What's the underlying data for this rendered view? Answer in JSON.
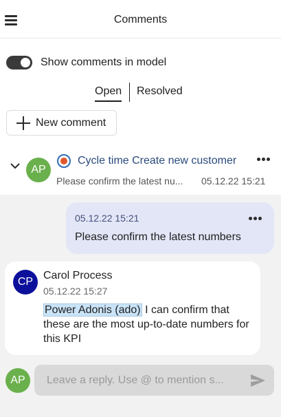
{
  "header": {
    "title": "Comments",
    "menu_icon": "hamburger-menu-icon"
  },
  "toggle": {
    "label": "Show comments in model",
    "state": "on"
  },
  "tabs": [
    {
      "label": "Open",
      "active": true
    },
    {
      "label": "Resolved",
      "active": false
    }
  ],
  "new_comment": {
    "label": "New comment",
    "icon": "plus-icon"
  },
  "thread": {
    "author_initials": "AP",
    "title": "Cycle time Create new customer",
    "preview": "Please confirm the latest nu...",
    "date": "05.12.22 15:21",
    "expanded": true
  },
  "messages": [
    {
      "date": "05.12.22 15:21",
      "text": "Please confirm the latest numbers",
      "own": true
    },
    {
      "initials": "CP",
      "author": "Carol Process",
      "date": "05.12.22 15:27",
      "mention": "Power Adonis (ado)",
      "text": " I can confirm that these are the most up-to-date numbers for this KPI",
      "own": false
    }
  ],
  "reply": {
    "initials": "AP",
    "placeholder": "Leave a reply. Use @ to mention s..."
  },
  "colors": {
    "accent_text": "#2a4a7b",
    "avatar_ap": "#6ab04c",
    "avatar_cp": "#0c109b",
    "own_bubble": "#e3e6f7",
    "thread_bg": "#f2f2f2",
    "mention_bg": "#c9e3f7"
  }
}
